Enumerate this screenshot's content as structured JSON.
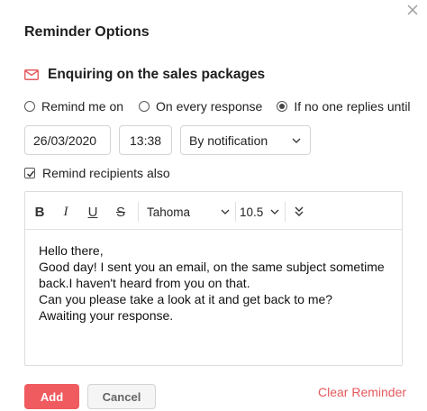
{
  "dialog": {
    "title": "Reminder Options",
    "subject": "Enquiring on the sales packages",
    "close_icon": "close-icon"
  },
  "reminder_type": {
    "options": [
      {
        "label": "Remind me on",
        "selected": false
      },
      {
        "label": "On every response",
        "selected": false
      },
      {
        "label": "If no one replies until",
        "selected": true
      }
    ]
  },
  "schedule": {
    "date": "26/03/2020",
    "time": "13:38",
    "notify_via": "By notification"
  },
  "remind_recipients": {
    "label": "Remind recipients also",
    "checked": true
  },
  "editor": {
    "toolbar": {
      "bold": "B",
      "italic": "I",
      "underline": "U",
      "strike": "S",
      "font": "Tahoma",
      "size": "10.5"
    },
    "body_lines": [
      "Hello there,",
      "Good day! I sent you an email, on the same subject sometime",
      "back.I haven't heard from you on that.",
      "Can you please take a look at it and get back to me?",
      "Awaiting your response."
    ]
  },
  "actions": {
    "add": "Add",
    "cancel": "Cancel",
    "clear": "Clear Reminder"
  },
  "colors": {
    "accent": "#ef5b5f",
    "link": "#e45a5d"
  }
}
